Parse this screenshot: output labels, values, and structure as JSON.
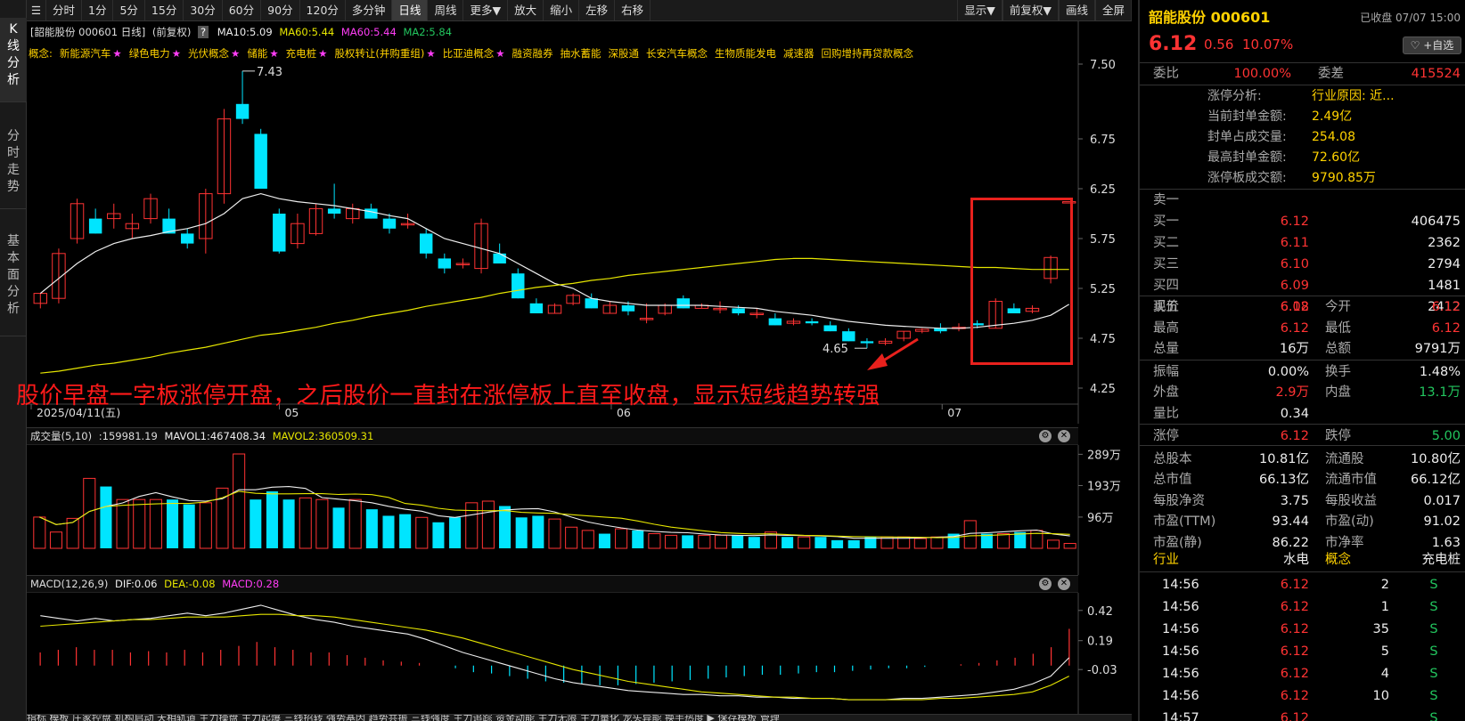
{
  "side_tabs": [
    "K线分析",
    "分时走势",
    "基本面分析"
  ],
  "toolbar": {
    "first": "☰",
    "items": [
      "分时",
      "1分",
      "5分",
      "15分",
      "30分",
      "60分",
      "90分",
      "120分",
      "多分钟",
      "日线",
      "周线",
      "更多▼",
      "放大",
      "缩小",
      "左移",
      "右移"
    ],
    "right_items": [
      "显示▼",
      "前复权▼",
      "画线",
      "全屏"
    ]
  },
  "chart_info": {
    "name": "[韶能股份 000601 日线]",
    "adj": "(前复权)",
    "q": "?",
    "ma10": "MA10:5.09",
    "ma60": "MA60:5.44",
    "ma60b": "MA60:5.44",
    "ma2": "MA2:5.84"
  },
  "concepts_label": "概念:",
  "concepts": [
    {
      "t": "新能源汽车",
      "s": "★"
    },
    {
      "t": "绿色电力",
      "s": "★"
    },
    {
      "t": "光伏概念",
      "s": "★"
    },
    {
      "t": "储能",
      "s": "★"
    },
    {
      "t": "充电桩",
      "s": "★"
    },
    {
      "t": "股权转让(并购重组)",
      "s": "★"
    },
    {
      "t": "比亚迪概念",
      "s": "★"
    },
    {
      "t": "融资融券",
      "s": ""
    },
    {
      "t": "抽水蓄能",
      "s": ""
    },
    {
      "t": "深股通",
      "s": ""
    },
    {
      "t": "长安汽车概念",
      "s": ""
    },
    {
      "t": "生物质能发电",
      "s": ""
    },
    {
      "t": "减速器",
      "s": ""
    },
    {
      "t": "回购增持再贷款概念",
      "s": ""
    }
  ],
  "price_axis": [
    "7.50",
    "6.75",
    "6.25",
    "5.75",
    "5.25",
    "4.75",
    "4.25"
  ],
  "date_axis": [
    "2025/04/11(五)",
    "05",
    "06",
    "07"
  ],
  "max_label": "7.43",
  "min_label": "4.65",
  "annotation": "股价早盘一字板涨停开盘，之后股价一直封在涨停板上直至收盘，显示短线趋势转强",
  "volume": {
    "title": "成交量(5,10)",
    "v": ":159981.19",
    "m1": "MAVOL1:467408.34",
    "m2": "MAVOL2:360509.31",
    "axis": [
      "289万",
      "193万",
      "96万"
    ]
  },
  "macd": {
    "title": "MACD(12,26,9)",
    "dif": "DIF:0.06",
    "dea": "DEA:-0.08",
    "macd": "MACD:0.28",
    "axis": [
      "0.42",
      "0.19",
      "-0.03"
    ]
  },
  "bottom_tabs": "指标 模板 庄家控盘 机构启动 天相轨道 主力操盘 主力起爆 三线招转 强势基因 趋势共振 三线强度 主力追踪 资金动能 主力无限 主力量化 龙头异能 换手热度 ▶ 保存模板 管理",
  "colors": {
    "up": "#ff3333",
    "down": "#00e5ff",
    "ma10": "#eeeeee",
    "ma60": "#e6e600",
    "accent": "#ffd200"
  },
  "quote": {
    "title": "韶能股份 000601",
    "status": "已收盘 07/07 15:00",
    "price": "6.12",
    "change": "0.56",
    "pct": "10.07%",
    "watch": "♡ +自选",
    "weibi_l": "委比",
    "weibi_v": "100.00%",
    "weicha_l": "委差",
    "weicha_v": "415524",
    "zt_rows": [
      {
        "l": "涨停分析:",
        "v": "行业原因: 近..."
      },
      {
        "l": "当前封单金额:",
        "v": "2.49亿"
      },
      {
        "l": "封单占成交量:",
        "v": "254.08"
      },
      {
        "l": "最高封单金额:",
        "v": "72.60亿"
      },
      {
        "l": "涨停板成交额:",
        "v": "9790.85万"
      }
    ],
    "sell_level": "卖一",
    "buy": [
      {
        "l": "买一",
        "p": "6.12",
        "v": "406475"
      },
      {
        "l": "买二",
        "p": "6.11",
        "v": "2362"
      },
      {
        "l": "买三",
        "p": "6.10",
        "v": "2794"
      },
      {
        "l": "买四",
        "p": "6.09",
        "v": "1481"
      },
      {
        "l": "买五",
        "p": "6.08",
        "v": "2412"
      }
    ],
    "stats": [
      [
        {
          "l": "现价",
          "v": "6.12",
          "c": "red"
        },
        {
          "l": "今开",
          "v": "6.12",
          "c": "red"
        }
      ],
      [
        {
          "l": "最高",
          "v": "6.12",
          "c": "red"
        },
        {
          "l": "最低",
          "v": "6.12",
          "c": "red"
        }
      ],
      [
        {
          "l": "总量",
          "v": "16万",
          "c": "white"
        },
        {
          "l": "总额",
          "v": "9791万",
          "c": "white"
        }
      ],
      [
        {
          "l": "振幅",
          "v": "0.00%",
          "c": "white"
        },
        {
          "l": "换手",
          "v": "1.48%",
          "c": "white"
        }
      ],
      [
        {
          "l": "外盘",
          "v": "2.9万",
          "c": "red"
        },
        {
          "l": "内盘",
          "v": "13.1万",
          "c": "green"
        }
      ],
      [
        {
          "l": "量比",
          "v": "0.34",
          "c": "white"
        },
        {
          "l": "",
          "v": "",
          "c": "white"
        }
      ],
      [
        {
          "l": "涨停",
          "v": "6.12",
          "c": "red"
        },
        {
          "l": "跌停",
          "v": "5.00",
          "c": "green"
        }
      ],
      [
        {
          "l": "总股本",
          "v": "10.81亿",
          "c": "white"
        },
        {
          "l": "流通股",
          "v": "10.80亿",
          "c": "white"
        }
      ],
      [
        {
          "l": "总市值",
          "v": "66.13亿",
          "c": "white"
        },
        {
          "l": "流通市值",
          "v": "66.12亿",
          "c": "white"
        }
      ],
      [
        {
          "l": "每股净资",
          "v": "3.75",
          "c": "white"
        },
        {
          "l": "每股收益",
          "v": "0.017",
          "c": "white"
        }
      ],
      [
        {
          "l": "市盈(TTM)",
          "v": "93.44",
          "c": "white"
        },
        {
          "l": "市盈(动)",
          "v": "91.02",
          "c": "white"
        }
      ],
      [
        {
          "l": "市盈(静)",
          "v": "86.22",
          "c": "white"
        },
        {
          "l": "市净率",
          "v": "1.63",
          "c": "white"
        }
      ]
    ],
    "industry_l": "行业",
    "industry_v": "水电",
    "concept_l": "概念",
    "concept_v": "充电桩",
    "ticks": [
      {
        "t": "14:56",
        "p": "6.12",
        "v": "2",
        "s": "S"
      },
      {
        "t": "14:56",
        "p": "6.12",
        "v": "1",
        "s": "S"
      },
      {
        "t": "14:56",
        "p": "6.12",
        "v": "35",
        "s": "S"
      },
      {
        "t": "14:56",
        "p": "6.12",
        "v": "5",
        "s": "S"
      },
      {
        "t": "14:56",
        "p": "6.12",
        "v": "4",
        "s": "S"
      },
      {
        "t": "14:56",
        "p": "6.12",
        "v": "10",
        "s": "S"
      },
      {
        "t": "14:57",
        "p": "6.12",
        "v": "",
        "s": "S"
      }
    ]
  },
  "chart_data": {
    "type": "candlestick",
    "title": "韶能股份 000601 日线",
    "ylim": [
      4.25,
      7.5
    ],
    "candles": [
      {
        "o": 5.1,
        "h": 5.2,
        "l": 5.05,
        "c": 5.2
      },
      {
        "o": 5.15,
        "h": 5.65,
        "l": 5.1,
        "c": 5.6
      },
      {
        "o": 5.75,
        "h": 6.15,
        "l": 5.7,
        "c": 6.1
      },
      {
        "o": 5.95,
        "h": 6.05,
        "l": 5.8,
        "c": 5.8
      },
      {
        "o": 5.95,
        "h": 6.1,
        "l": 5.85,
        "c": 6.0
      },
      {
        "o": 5.85,
        "h": 6.0,
        "l": 5.75,
        "c": 5.9
      },
      {
        "o": 5.95,
        "h": 6.2,
        "l": 5.9,
        "c": 6.15
      },
      {
        "o": 5.95,
        "h": 6.05,
        "l": 5.8,
        "c": 5.8
      },
      {
        "o": 5.8,
        "h": 5.85,
        "l": 5.65,
        "c": 5.7
      },
      {
        "o": 5.75,
        "h": 6.25,
        "l": 5.6,
        "c": 6.2
      },
      {
        "o": 6.2,
        "h": 7.05,
        "l": 6.1,
        "c": 6.95
      },
      {
        "o": 7.1,
        "h": 7.43,
        "l": 6.9,
        "c": 6.95
      },
      {
        "o": 6.8,
        "h": 6.85,
        "l": 6.25,
        "c": 6.25
      },
      {
        "o": 6.0,
        "h": 6.05,
        "l": 5.6,
        "c": 5.62
      },
      {
        "o": 5.7,
        "h": 6.0,
        "l": 5.65,
        "c": 5.9
      },
      {
        "o": 5.8,
        "h": 6.1,
        "l": 5.78,
        "c": 6.05
      },
      {
        "o": 6.05,
        "h": 6.3,
        "l": 5.95,
        "c": 6.0
      },
      {
        "o": 5.95,
        "h": 6.1,
        "l": 5.9,
        "c": 6.05
      },
      {
        "o": 6.05,
        "h": 6.1,
        "l": 5.95,
        "c": 5.95
      },
      {
        "o": 5.95,
        "h": 6.0,
        "l": 5.8,
        "c": 5.85
      },
      {
        "o": 5.9,
        "h": 6.0,
        "l": 5.85,
        "c": 5.9
      },
      {
        "o": 5.8,
        "h": 5.85,
        "l": 5.55,
        "c": 5.6
      },
      {
        "o": 5.55,
        "h": 5.6,
        "l": 5.4,
        "c": 5.45
      },
      {
        "o": 5.5,
        "h": 5.55,
        "l": 5.45,
        "c": 5.5
      },
      {
        "o": 5.45,
        "h": 5.95,
        "l": 5.4,
        "c": 5.9
      },
      {
        "o": 5.6,
        "h": 5.7,
        "l": 5.5,
        "c": 5.5
      },
      {
        "o": 5.4,
        "h": 5.45,
        "l": 5.15,
        "c": 5.15
      },
      {
        "o": 5.1,
        "h": 5.15,
        "l": 5.0,
        "c": 5.0
      },
      {
        "o": 5.0,
        "h": 5.1,
        "l": 5.0,
        "c": 5.08
      },
      {
        "o": 5.1,
        "h": 5.2,
        "l": 5.08,
        "c": 5.18
      },
      {
        "o": 5.15,
        "h": 5.2,
        "l": 5.05,
        "c": 5.05
      },
      {
        "o": 5.0,
        "h": 5.12,
        "l": 5.0,
        "c": 5.08
      },
      {
        "o": 5.08,
        "h": 5.12,
        "l": 4.98,
        "c": 5.02
      },
      {
        "o": 4.95,
        "h": 5.1,
        "l": 4.9,
        "c": 4.95
      },
      {
        "o": 5.0,
        "h": 5.1,
        "l": 4.98,
        "c": 5.08
      },
      {
        "o": 5.15,
        "h": 5.18,
        "l": 5.05,
        "c": 5.05
      },
      {
        "o": 5.05,
        "h": 5.1,
        "l": 5.05,
        "c": 5.08
      },
      {
        "o": 5.05,
        "h": 5.12,
        "l": 5.0,
        "c": 5.05
      },
      {
        "o": 5.05,
        "h": 5.08,
        "l": 4.98,
        "c": 5.0
      },
      {
        "o": 5.0,
        "h": 5.05,
        "l": 4.95,
        "c": 5.0
      },
      {
        "o": 4.95,
        "h": 5.0,
        "l": 4.88,
        "c": 4.88
      },
      {
        "o": 4.9,
        "h": 4.95,
        "l": 4.88,
        "c": 4.92
      },
      {
        "o": 4.92,
        "h": 4.95,
        "l": 4.88,
        "c": 4.9
      },
      {
        "o": 4.88,
        "h": 4.92,
        "l": 4.82,
        "c": 4.82
      },
      {
        "o": 4.82,
        "h": 4.85,
        "l": 4.72,
        "c": 4.72
      },
      {
        "o": 4.72,
        "h": 4.75,
        "l": 4.65,
        "c": 4.7
      },
      {
        "o": 4.7,
        "h": 4.75,
        "l": 4.68,
        "c": 4.72
      },
      {
        "o": 4.75,
        "h": 4.82,
        "l": 4.72,
        "c": 4.82
      },
      {
        "o": 4.82,
        "h": 4.85,
        "l": 4.8,
        "c": 4.84
      },
      {
        "o": 4.85,
        "h": 4.9,
        "l": 4.8,
        "c": 4.82
      },
      {
        "o": 4.85,
        "h": 4.9,
        "l": 4.82,
        "c": 4.86
      },
      {
        "o": 4.9,
        "h": 4.93,
        "l": 4.85,
        "c": 4.88
      },
      {
        "o": 4.85,
        "h": 5.15,
        "l": 4.85,
        "c": 5.12
      },
      {
        "o": 5.05,
        "h": 5.1,
        "l": 5.0,
        "c": 5.0
      },
      {
        "o": 5.02,
        "h": 5.08,
        "l": 5.0,
        "c": 5.05
      },
      {
        "o": 5.35,
        "h": 5.58,
        "l": 5.3,
        "c": 5.56
      },
      {
        "o": 6.12,
        "h": 6.12,
        "l": 6.12,
        "c": 6.12
      }
    ],
    "ma10": [
      5.2,
      5.35,
      5.5,
      5.62,
      5.7,
      5.75,
      5.78,
      5.82,
      5.85,
      5.9,
      6.0,
      6.15,
      6.2,
      6.15,
      6.12,
      6.1,
      6.08,
      6.05,
      6.02,
      5.98,
      5.95,
      5.85,
      5.75,
      5.7,
      5.65,
      5.6,
      5.5,
      5.4,
      5.3,
      5.25,
      5.15,
      5.12,
      5.1,
      5.08,
      5.08,
      5.08,
      5.08,
      5.07,
      5.06,
      5.05,
      5.02,
      5.0,
      4.98,
      4.95,
      4.92,
      4.9,
      4.88,
      4.87,
      4.86,
      4.85,
      4.85,
      4.86,
      4.88,
      4.9,
      4.93,
      4.98,
      5.09
    ],
    "ma60": [
      4.4,
      4.42,
      4.45,
      4.48,
      4.5,
      4.53,
      4.56,
      4.6,
      4.63,
      4.66,
      4.7,
      4.74,
      4.78,
      4.8,
      4.83,
      4.86,
      4.9,
      4.93,
      4.97,
      5.0,
      5.03,
      5.07,
      5.1,
      5.13,
      5.16,
      5.2,
      5.23,
      5.26,
      5.28,
      5.3,
      5.33,
      5.35,
      5.38,
      5.4,
      5.42,
      5.44,
      5.46,
      5.48,
      5.5,
      5.52,
      5.54,
      5.55,
      5.55,
      5.54,
      5.53,
      5.52,
      5.51,
      5.5,
      5.49,
      5.48,
      5.47,
      5.46,
      5.46,
      5.45,
      5.44,
      5.44,
      5.44
    ],
    "volume": [
      96,
      50,
      92,
      215,
      190,
      150,
      150,
      150,
      150,
      135,
      140,
      185,
      290,
      150,
      175,
      150,
      155,
      150,
      125,
      150,
      120,
      100,
      105,
      95,
      80,
      95,
      140,
      145,
      130,
      95,
      100,
      90,
      65,
      55,
      45,
      60,
      55,
      45,
      40,
      40,
      40,
      40,
      40,
      35,
      50,
      35,
      35,
      35,
      25,
      25,
      35,
      35,
      35,
      30,
      35,
      45,
      85,
      45,
      45,
      50,
      55,
      25,
      15
    ],
    "volume_ylim": [
      0,
      290
    ],
    "macd_hist": [
      0.1,
      0.12,
      0.14,
      0.12,
      0.12,
      0.1,
      0.11,
      0.1,
      0.12,
      0.1,
      0.12,
      0.15,
      0.18,
      0.14,
      0.12,
      0.1,
      0.1,
      0.08,
      0.06,
      0.04,
      0.03,
      0.02,
      0.0,
      -0.02,
      -0.05,
      -0.06,
      -0.08,
      -0.1,
      -0.12,
      -0.13,
      -0.14,
      -0.15,
      -0.15,
      -0.14,
      -0.13,
      -0.12,
      -0.11,
      -0.1,
      -0.09,
      -0.08,
      -0.07,
      -0.07,
      -0.06,
      -0.05,
      -0.05,
      -0.04,
      -0.03,
      -0.02,
      -0.02,
      -0.01,
      0.0,
      0.01,
      0.02,
      0.04,
      0.06,
      0.09,
      0.14,
      0.28
    ],
    "dif": [
      0.38,
      0.36,
      0.34,
      0.36,
      0.34,
      0.35,
      0.36,
      0.38,
      0.4,
      0.38,
      0.4,
      0.43,
      0.46,
      0.42,
      0.38,
      0.35,
      0.33,
      0.3,
      0.28,
      0.26,
      0.24,
      0.2,
      0.15,
      0.1,
      0.06,
      0.02,
      -0.02,
      -0.06,
      -0.1,
      -0.13,
      -0.15,
      -0.17,
      -0.19,
      -0.2,
      -0.21,
      -0.22,
      -0.22,
      -0.23,
      -0.23,
      -0.24,
      -0.24,
      -0.25,
      -0.25,
      -0.25,
      -0.26,
      -0.26,
      -0.26,
      -0.25,
      -0.25,
      -0.24,
      -0.23,
      -0.22,
      -0.2,
      -0.18,
      -0.14,
      -0.08,
      0.06
    ],
    "dea": [
      0.3,
      0.31,
      0.32,
      0.33,
      0.34,
      0.35,
      0.35,
      0.36,
      0.37,
      0.37,
      0.37,
      0.38,
      0.39,
      0.39,
      0.38,
      0.38,
      0.37,
      0.35,
      0.33,
      0.31,
      0.29,
      0.27,
      0.24,
      0.21,
      0.17,
      0.13,
      0.09,
      0.05,
      0.01,
      -0.03,
      -0.06,
      -0.09,
      -0.12,
      -0.14,
      -0.16,
      -0.18,
      -0.2,
      -0.21,
      -0.22,
      -0.23,
      -0.24,
      -0.24,
      -0.25,
      -0.25,
      -0.26,
      -0.26,
      -0.26,
      -0.26,
      -0.26,
      -0.25,
      -0.25,
      -0.24,
      -0.23,
      -0.22,
      -0.2,
      -0.15,
      -0.08
    ],
    "macd_ylim": [
      -0.3,
      0.5
    ]
  }
}
